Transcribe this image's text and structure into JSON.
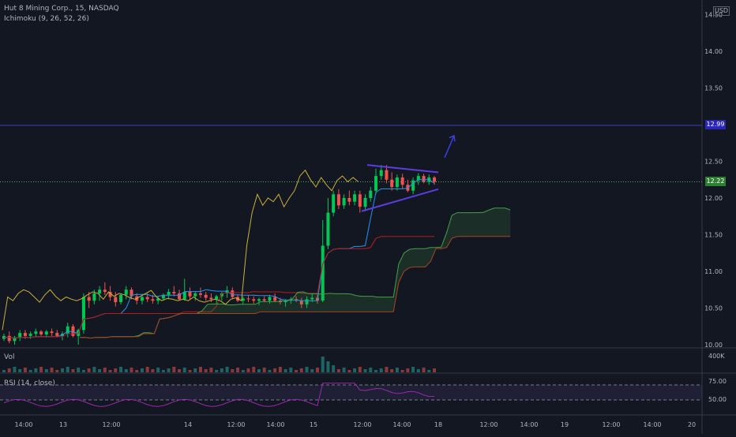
{
  "legend": {
    "symbol_line": "Hut 8 Mining Corp., 15, NASDAQ",
    "indicator_line": "Ichimoku (9, 26, 52, 26)"
  },
  "currency": "USD",
  "price_tags": {
    "level_high": "12.99",
    "last_price": "12.22"
  },
  "volume_pane": {
    "label": "Vol",
    "axis_label": "400K"
  },
  "rsi_pane": {
    "label": "RSI (14, close)",
    "levels": [
      "75.00",
      "50.00"
    ]
  },
  "colors": {
    "background": "#131722",
    "up": "#26a69a",
    "up_bright": "#00c853",
    "down": "#ef5350",
    "tenkan": "#2196f3",
    "kijun": "#b71c1c",
    "lagging": "#c9b03b",
    "span_a": "#43a047",
    "span_b": "#a5451f",
    "rsi": "#9c27b0",
    "level_line": "#3f3fd4",
    "last_line": "#4caf50",
    "pattern": "#5b3de0"
  },
  "chart_data": {
    "type": "candlestick",
    "title": "Hut 8 Mining Corp., 15, NASDAQ",
    "y_ticks": [
      "10.00",
      "10.50",
      "11.00",
      "11.50",
      "12.00",
      "12.50",
      "13.00",
      "13.50",
      "14.00",
      "14.50"
    ],
    "ylim": [
      10.0,
      14.6
    ],
    "x_ticks": [
      "14:00",
      "13",
      "12:00",
      "14",
      "12:00",
      "14:00",
      "15",
      "12:00",
      "14:00",
      "18",
      "12:00",
      "14:00",
      "19",
      "12:00",
      "14:00",
      "20"
    ],
    "horizontal_levels": [
      12.99,
      12.22
    ],
    "series": [
      {
        "name": "price",
        "candles": [
          [
            10.08,
            10.15,
            10.05,
            10.12
          ],
          [
            10.12,
            10.18,
            10.02,
            10.05
          ],
          [
            10.05,
            10.12,
            10.0,
            10.1
          ],
          [
            10.1,
            10.2,
            10.05,
            10.16
          ],
          [
            10.16,
            10.2,
            10.08,
            10.12
          ],
          [
            10.12,
            10.18,
            10.08,
            10.15
          ],
          [
            10.15,
            10.22,
            10.1,
            10.18
          ],
          [
            10.18,
            10.2,
            10.12,
            10.14
          ],
          [
            10.14,
            10.2,
            10.1,
            10.18
          ],
          [
            10.18,
            10.22,
            10.12,
            10.16
          ],
          [
            10.16,
            10.2,
            10.1,
            10.12
          ],
          [
            10.12,
            10.18,
            10.06,
            10.15
          ],
          [
            10.15,
            10.3,
            10.1,
            10.25
          ],
          [
            10.25,
            10.28,
            10.1,
            10.12
          ],
          [
            10.12,
            10.22,
            10.0,
            10.2
          ],
          [
            10.2,
            10.7,
            10.15,
            10.65
          ],
          [
            10.65,
            10.72,
            10.5,
            10.6
          ],
          [
            10.6,
            10.75,
            10.55,
            10.7
          ],
          [
            10.7,
            10.8,
            10.6,
            10.75
          ],
          [
            10.75,
            10.85,
            10.68,
            10.72
          ],
          [
            10.72,
            10.8,
            10.6,
            10.65
          ],
          [
            10.65,
            10.72,
            10.52,
            10.58
          ],
          [
            10.58,
            10.7,
            10.55,
            10.68
          ],
          [
            10.68,
            10.8,
            10.62,
            10.75
          ],
          [
            10.75,
            10.78,
            10.62,
            10.66
          ],
          [
            10.66,
            10.7,
            10.55,
            10.6
          ],
          [
            10.6,
            10.68,
            10.55,
            10.65
          ],
          [
            10.65,
            10.7,
            10.58,
            10.62
          ],
          [
            10.62,
            10.68,
            10.56,
            10.6
          ],
          [
            10.6,
            10.66,
            10.55,
            10.63
          ],
          [
            10.63,
            10.7,
            10.6,
            10.68
          ],
          [
            10.68,
            10.76,
            10.62,
            10.72
          ],
          [
            10.72,
            10.8,
            10.66,
            10.7
          ],
          [
            10.7,
            10.75,
            10.6,
            10.62
          ],
          [
            10.62,
            10.9,
            10.6,
            10.72
          ],
          [
            10.72,
            10.78,
            10.62,
            10.66
          ],
          [
            10.66,
            10.72,
            10.6,
            10.7
          ],
          [
            10.7,
            10.78,
            10.64,
            10.68
          ],
          [
            10.68,
            10.72,
            10.6,
            10.64
          ],
          [
            10.64,
            10.7,
            10.58,
            10.62
          ],
          [
            10.62,
            10.68,
            10.56,
            10.66
          ],
          [
            10.66,
            10.72,
            10.6,
            10.7
          ],
          [
            10.7,
            10.8,
            10.64,
            10.74
          ],
          [
            10.74,
            10.78,
            10.62,
            10.65
          ],
          [
            10.65,
            10.68,
            10.58,
            10.6
          ],
          [
            10.6,
            10.66,
            10.55,
            10.63
          ],
          [
            10.63,
            10.68,
            10.58,
            10.62
          ],
          [
            10.62,
            10.66,
            10.56,
            10.6
          ],
          [
            10.6,
            10.64,
            10.54,
            10.62
          ],
          [
            10.62,
            10.66,
            10.58,
            10.6
          ],
          [
            10.6,
            10.68,
            10.56,
            10.65
          ],
          [
            10.65,
            10.7,
            10.58,
            10.6
          ],
          [
            10.6,
            10.64,
            10.55,
            10.58
          ],
          [
            10.58,
            10.62,
            10.52,
            10.6
          ],
          [
            10.6,
            10.65,
            10.56,
            10.62
          ],
          [
            10.62,
            10.66,
            10.58,
            10.6
          ],
          [
            10.6,
            10.64,
            10.5,
            10.55
          ],
          [
            10.55,
            10.66,
            10.5,
            10.62
          ],
          [
            10.62,
            10.7,
            10.58,
            10.64
          ],
          [
            10.64,
            10.68,
            10.56,
            10.6
          ],
          [
            10.6,
            11.7,
            10.58,
            11.35
          ],
          [
            11.35,
            12.0,
            11.3,
            11.8
          ],
          [
            11.8,
            12.1,
            11.75,
            12.05
          ],
          [
            12.05,
            12.12,
            11.85,
            11.9
          ],
          [
            11.9,
            12.05,
            11.85,
            12.0
          ],
          [
            12.0,
            12.1,
            11.9,
            11.95
          ],
          [
            11.95,
            12.1,
            11.9,
            12.05
          ],
          [
            12.05,
            12.1,
            11.8,
            11.88
          ],
          [
            11.88,
            12.05,
            11.82,
            12.0
          ],
          [
            12.0,
            12.15,
            11.95,
            12.1
          ],
          [
            12.1,
            12.4,
            12.05,
            12.3
          ],
          [
            12.3,
            12.45,
            12.25,
            12.38
          ],
          [
            12.38,
            12.45,
            12.2,
            12.25
          ],
          [
            12.25,
            12.35,
            12.1,
            12.15
          ],
          [
            12.15,
            12.32,
            12.1,
            12.28
          ],
          [
            12.28,
            12.33,
            12.12,
            12.18
          ],
          [
            12.18,
            12.25,
            12.08,
            12.1
          ],
          [
            12.1,
            12.28,
            12.05,
            12.24
          ],
          [
            12.24,
            12.34,
            12.18,
            12.3
          ],
          [
            12.3,
            12.33,
            12.2,
            12.22
          ],
          [
            12.22,
            12.32,
            12.18,
            12.28
          ],
          [
            12.28,
            12.3,
            12.18,
            12.22
          ]
        ]
      }
    ]
  }
}
